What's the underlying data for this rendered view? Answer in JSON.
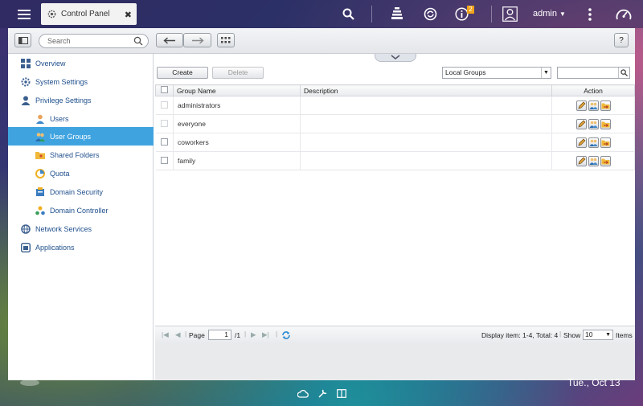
{
  "topbar": {
    "tab_title": "Control Panel",
    "user": "admin",
    "notification_count": "2"
  },
  "toolbar": {
    "search_placeholder": "Search",
    "help_label": "?"
  },
  "sidebar": {
    "items": [
      {
        "label": "Overview"
      },
      {
        "label": "System Settings"
      },
      {
        "label": "Privilege Settings"
      },
      {
        "label": "Users"
      },
      {
        "label": "User Groups"
      },
      {
        "label": "Shared Folders"
      },
      {
        "label": "Quota"
      },
      {
        "label": "Domain Security"
      },
      {
        "label": "Domain Controller"
      },
      {
        "label": "Network Services"
      },
      {
        "label": "Applications"
      }
    ]
  },
  "content": {
    "create_label": "Create",
    "delete_label": "Delete",
    "group_type": "Local Groups",
    "columns": {
      "name": "Group Name",
      "description": "Description",
      "action": "Action"
    },
    "rows": [
      {
        "name": "administrators",
        "description": ""
      },
      {
        "name": "everyone",
        "description": ""
      },
      {
        "name": "coworkers",
        "description": ""
      },
      {
        "name": "family",
        "description": ""
      }
    ],
    "pager": {
      "page_label": "Page",
      "page_value": "1",
      "total_pages": "/1",
      "display_text": "Display item: 1-4, Total: 4",
      "show_label": "Show",
      "show_value": "10",
      "items_label": "Items"
    }
  },
  "desktop": {
    "date": "Tue., Oct 13"
  }
}
